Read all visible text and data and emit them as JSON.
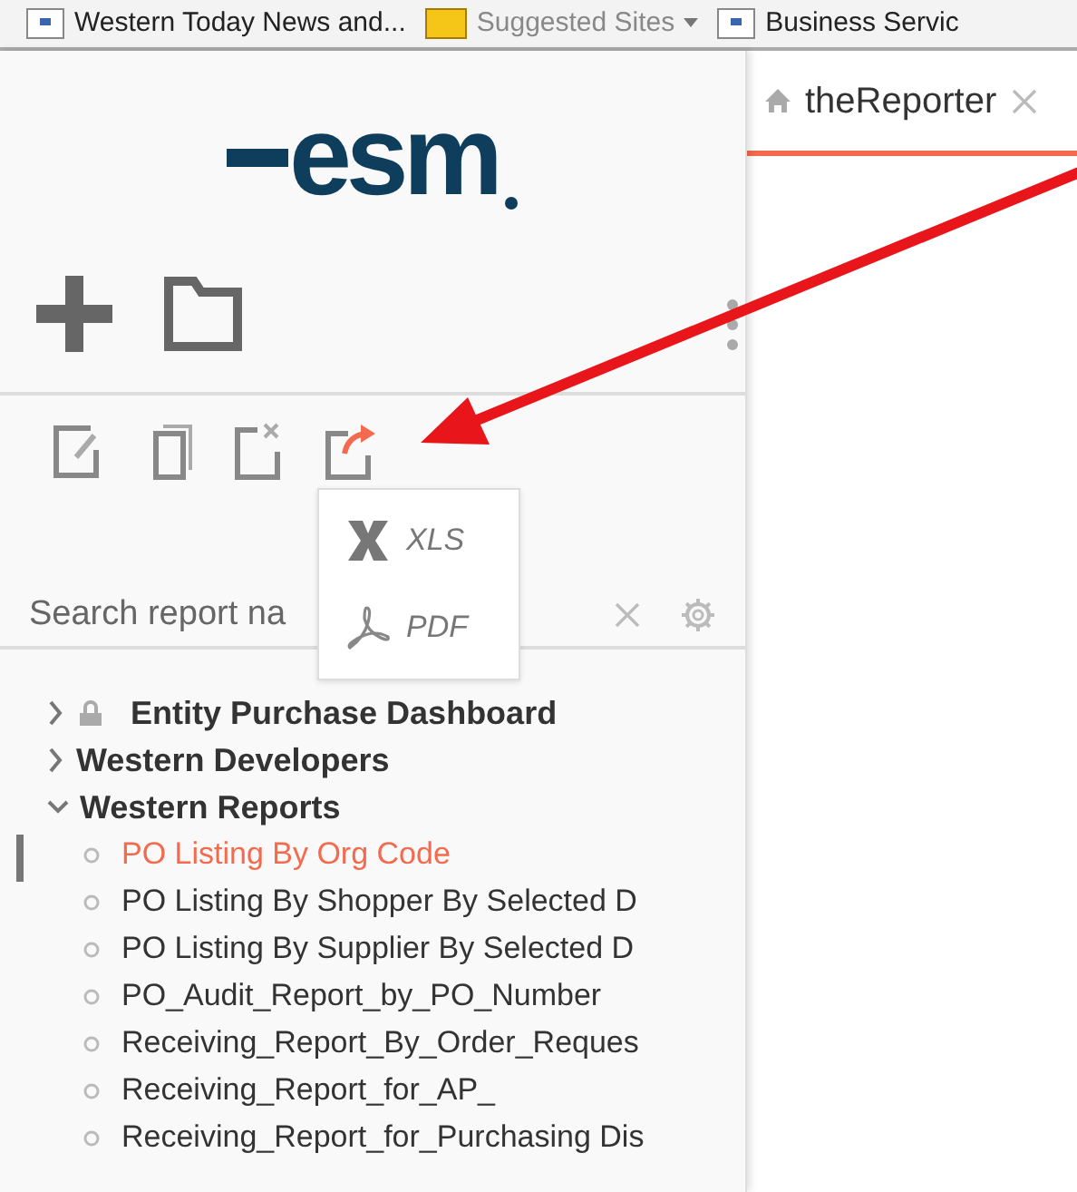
{
  "bookmarks": [
    {
      "label": "Western Today  News and...",
      "kind": "page"
    },
    {
      "label": "Suggested Sites",
      "kind": "folder"
    },
    {
      "label": "Business Servic",
      "kind": "page"
    }
  ],
  "logo": "esm",
  "tab": {
    "label": "theReporter",
    "selected": true
  },
  "toolbar": [
    {
      "kind": "edit",
      "active": false
    },
    {
      "kind": "copy",
      "active": false
    },
    {
      "kind": "delete",
      "active": false
    },
    {
      "kind": "export",
      "active": true
    }
  ],
  "export_menu": [
    {
      "kind": "xls",
      "label": "XLS"
    },
    {
      "kind": "pdf",
      "label": "PDF"
    }
  ],
  "search": {
    "placeholder": "Search report na"
  },
  "tree": [
    {
      "label": "Entity Purchase Dashboard",
      "expanded": false,
      "locked": true
    },
    {
      "label": "Western Developers",
      "expanded": false,
      "locked": false
    },
    {
      "label": "Western Reports",
      "expanded": true,
      "locked": false,
      "children": [
        {
          "label": "PO Listing By Org Code",
          "selected": true
        },
        {
          "label": "PO Listing By Shopper By Selected D",
          "selected": false
        },
        {
          "label": "PO Listing By Supplier By Selected D",
          "selected": false
        },
        {
          "label": "PO_Audit_Report_by_PO_Number",
          "selected": false
        },
        {
          "label": "Receiving_Report_By_Order_Reques",
          "selected": false
        },
        {
          "label": "Receiving_Report_for_AP_",
          "selected": false
        },
        {
          "label": "Receiving_Report_for_Purchasing Dis",
          "selected": false
        }
      ]
    }
  ]
}
